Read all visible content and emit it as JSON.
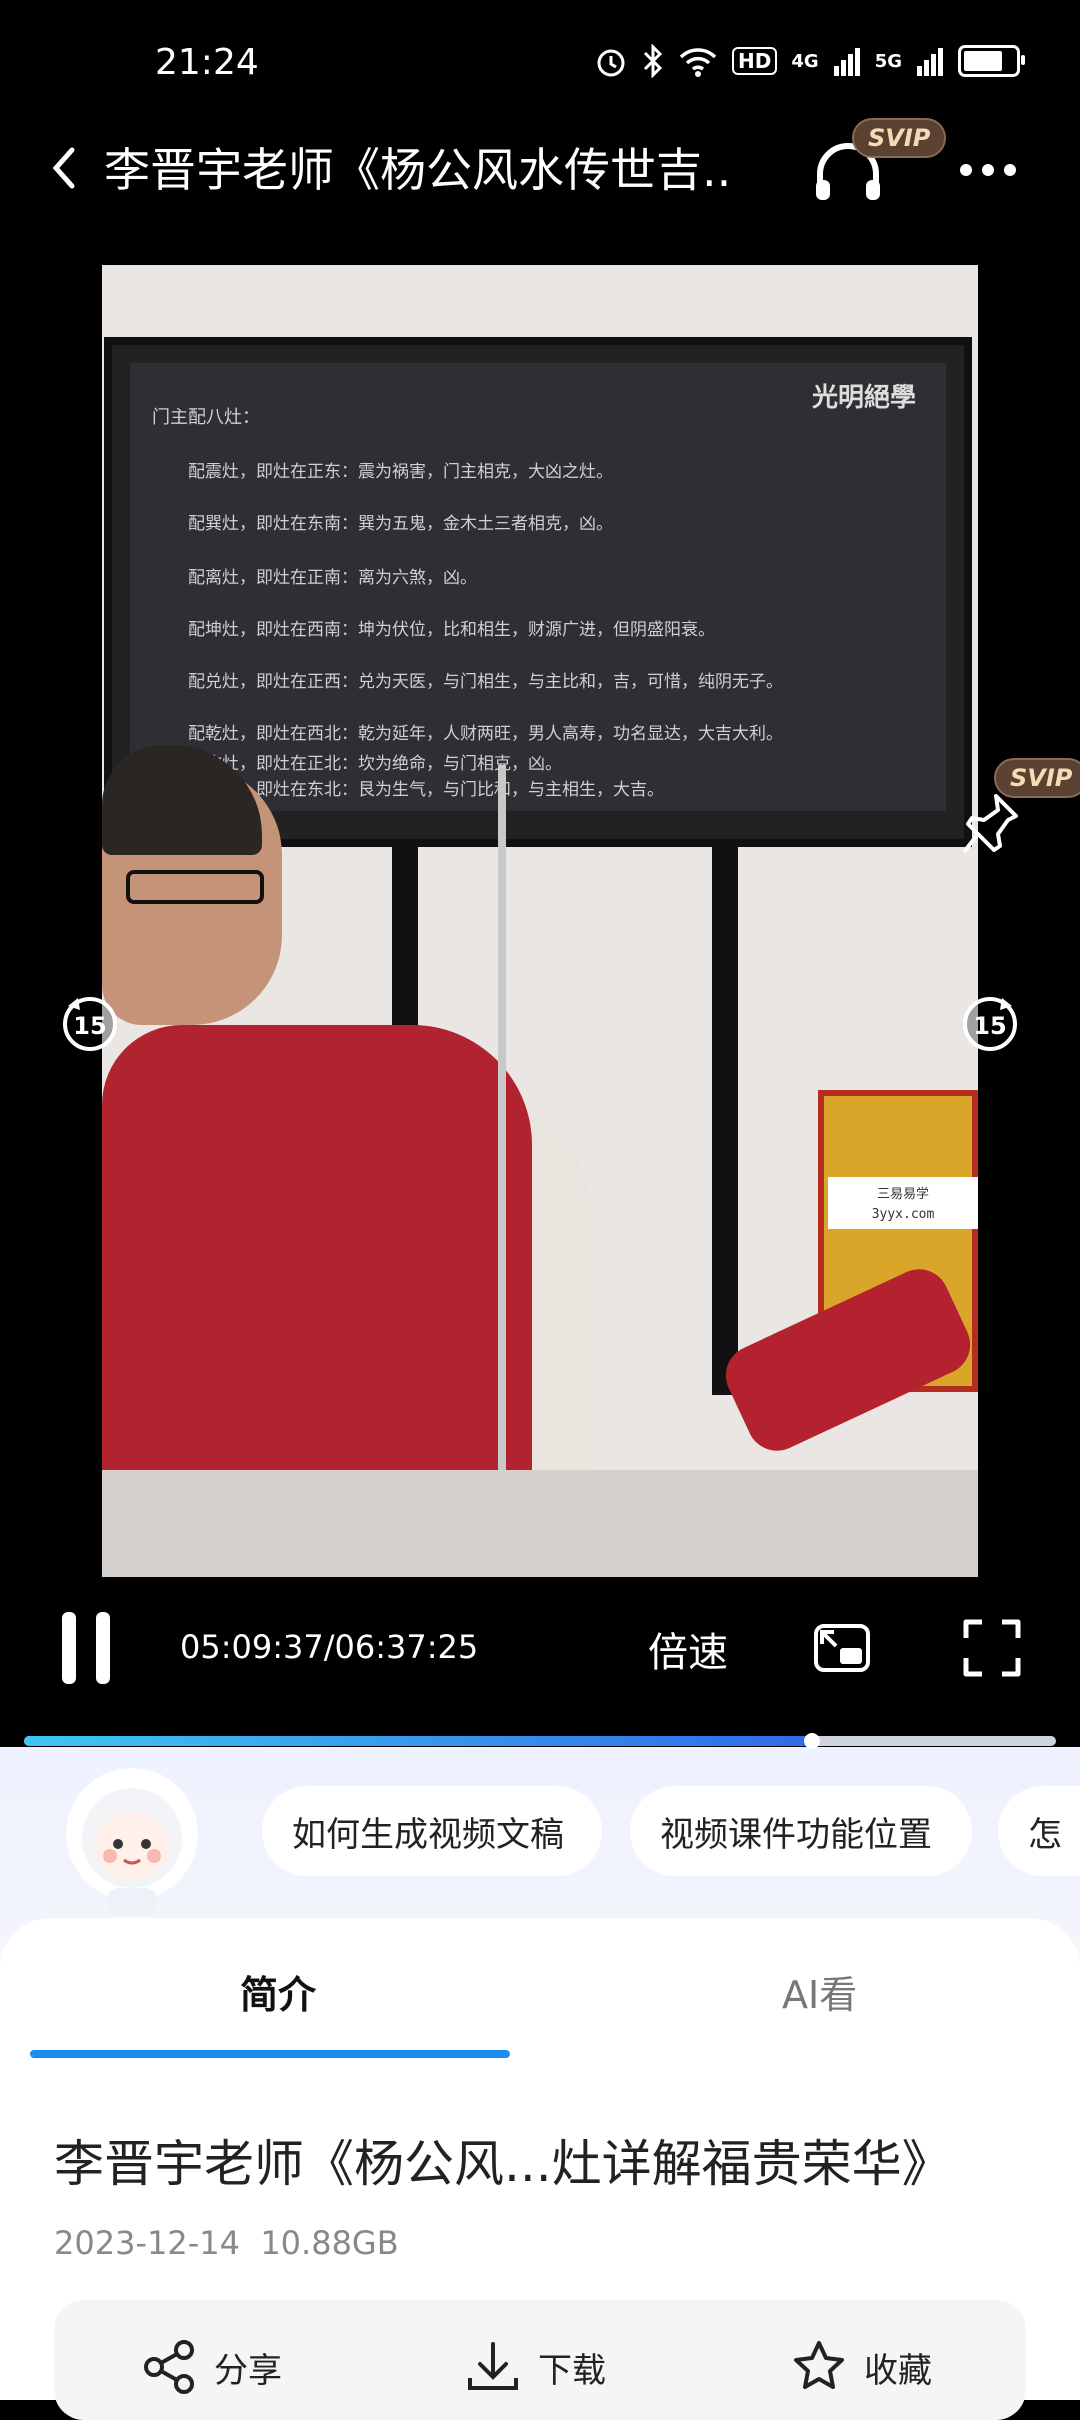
{
  "status_bar": {
    "time": "21:24",
    "network_badge": "HD",
    "signal_4g": "4G",
    "signal_5g": "5G",
    "battery_level": 0.76
  },
  "header": {
    "title": "李晋宇老师《杨公风水传世吉..",
    "vip_badge": "SVIP"
  },
  "video": {
    "screen_logo": "光明絕學",
    "screen_heading": "门主配八灶：",
    "screen_lines": [
      "配震灶，即灶在正东：震为祸害，门主相克，大凶之灶。",
      "配巽灶，即灶在东南：巽为五鬼，金木土三者相克，凶。",
      "配离灶，即灶在正南：离为六煞，凶。",
      "配坤灶，即灶在西南：坤为伏位，比和相生，财源广进，但阴盛阳衰。",
      "配兑灶，即灶在正西：兑为天医，与门相生，与主比和，吉，可惜，纯阴无子。",
      "配乾灶，即灶在西北：乾为延年，人财两旺，男人高寿，功名显达，大吉大利。",
      "配坎灶，即灶在正北：坎为绝命，与门相克，凶。",
      "配艮灶，即灶在东北：艮为生气，与门比和，与主相生，大吉。"
    ],
    "watermark_line1": "三易易学",
    "watermark_line2": "3yyx.com",
    "skip_back": "15",
    "skip_forward": "15",
    "side_vip_badge": "SVIP"
  },
  "controls": {
    "timecode": "05:09:37/06:37:25",
    "speed_label": "倍速",
    "progress": 0.764
  },
  "suggestions": [
    "如何生成视频文稿",
    "视频课件功能位置",
    "怎"
  ],
  "tabs": {
    "intro": "简介",
    "ai_watch": "AI看"
  },
  "details": {
    "title": "李晋宇老师《杨公风...灶详解福贵荣华》",
    "date": "2023-12-14",
    "size": "10.88GB"
  },
  "actions": {
    "share": "分享",
    "download": "下载",
    "favorite": "收藏"
  }
}
